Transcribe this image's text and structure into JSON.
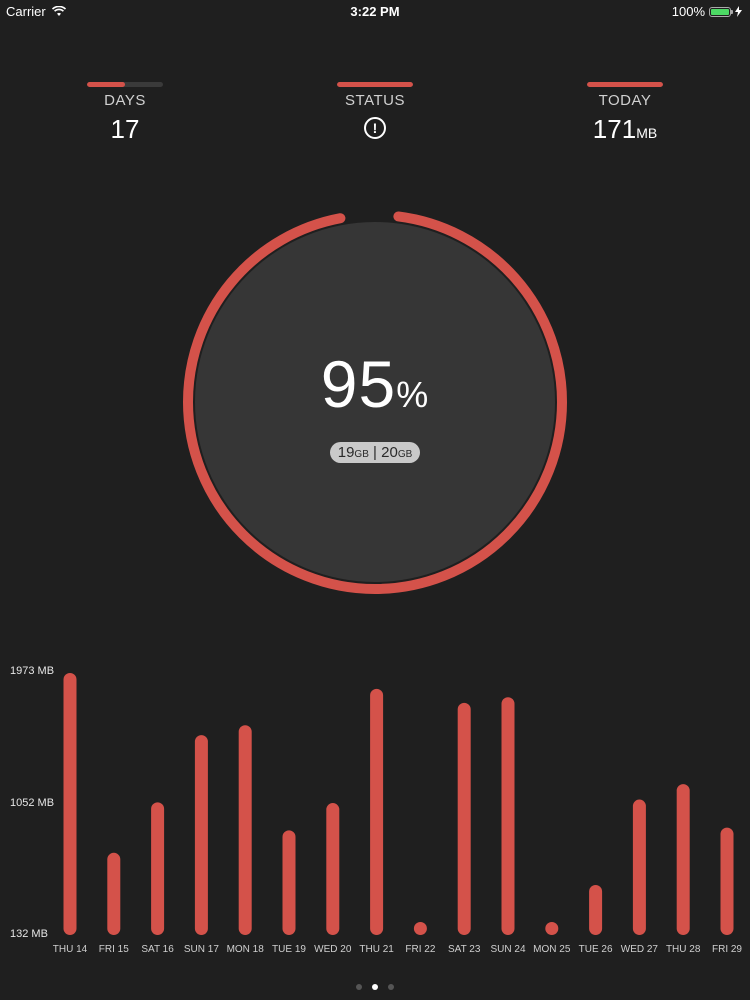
{
  "status_bar": {
    "carrier": "Carrier",
    "time": "3:22 PM",
    "battery": "100%"
  },
  "stats": {
    "days": {
      "label": "DAYS",
      "value": "17",
      "bar_fill": 0.5
    },
    "status": {
      "label": "STATUS",
      "icon": "info-icon",
      "bar_fill": 1.0
    },
    "today": {
      "label": "TODAY",
      "value": "171",
      "unit": "MB",
      "bar_fill": 1.0
    }
  },
  "gauge": {
    "percent": 95,
    "percent_text": "95",
    "percent_sign": "%",
    "used": "19",
    "used_unit": "GB",
    "separator": "|",
    "total": "20",
    "total_unit": "GB"
  },
  "colors": {
    "accent": "#d4524a",
    "background": "#1f1f1f",
    "gauge_fill": "#363636"
  },
  "chart_data": {
    "type": "bar",
    "categories": [
      "THU 14",
      "FRI 15",
      "SAT 16",
      "SUN 17",
      "MON 18",
      "TUE 19",
      "WED 20",
      "THU 21",
      "FRI 22",
      "SAT 23",
      "SUN 24",
      "MON 25",
      "TUE 26",
      "WED 27",
      "THU 28",
      "FRI 29"
    ],
    "values": [
      1973,
      690,
      1050,
      1530,
      1600,
      850,
      1045,
      1860,
      165,
      1760,
      1800,
      150,
      460,
      1070,
      1180,
      870
    ],
    "ytick_labels": [
      "1973 MB",
      "1052  MB",
      "132 MB"
    ],
    "ylim": [
      132,
      1973
    ],
    "grid": false
  },
  "pager": {
    "count": 3,
    "active": 1
  }
}
